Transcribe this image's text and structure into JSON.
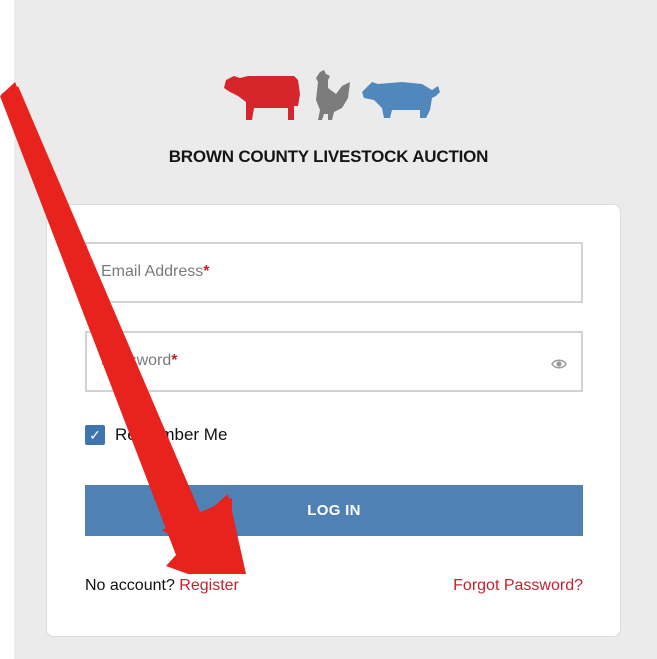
{
  "brand": {
    "title": "BROWN COUNTY LIVESTOCK AUCTION",
    "colors": {
      "cow": "#d6262b",
      "chicken": "#7c7c7c",
      "pig": "#5087bd"
    },
    "icons": [
      "cow-icon",
      "chicken-icon",
      "pig-icon"
    ]
  },
  "form": {
    "email_placeholder": "Email Address",
    "password_placeholder": "Password",
    "required_marker": "*",
    "remember_label": "Remember Me",
    "remember_checked": true,
    "login_label": "LOG IN",
    "no_account_text": "No account?",
    "register_label": "Register",
    "forgot_label": "Forgot Password?"
  },
  "annotation": {
    "arrow_color": "#e8221c",
    "icon": "pointer-arrow-icon"
  }
}
